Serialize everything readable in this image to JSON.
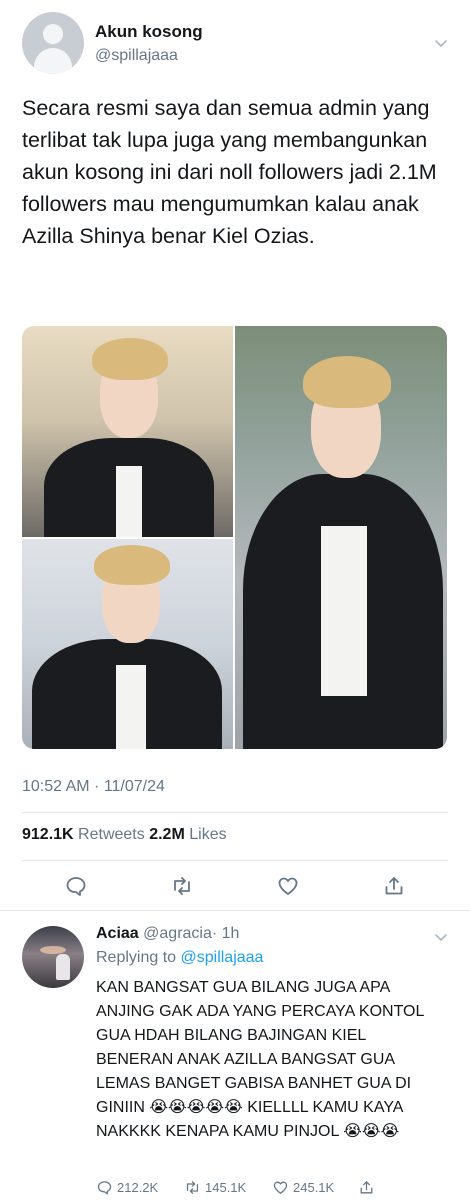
{
  "tweet": {
    "display_name": "Akun kosong",
    "handle": "@spillajaaa",
    "text": "Secara resmi saya dan semua admin yang terlibat tak lupa juga yang membangunkan akun kosong ini dari noll followers jadi 2.1M followers mau mengumumkan kalau anak Azilla Shinya benar Kiel Ozias.",
    "timestamp": "10:52 AM · 11/07/24",
    "retweets_count": "912.1K",
    "retweets_label": "Retweets",
    "likes_count": "2.2M",
    "likes_label": "Likes",
    "icons": [
      "chevron-down-icon",
      "reply-icon",
      "retweet-icon",
      "like-icon",
      "share-icon"
    ]
  },
  "reply": {
    "display_name": "Aciaa",
    "handle": "@agracia",
    "time": "· 1h",
    "replying_label": "Replying to",
    "replying_to": "@spillajaaa",
    "text": "KAN BANGSAT GUA BILANG JUGA APA ANJING GAK ADA YANG PERCAYA KONTOL GUA HDAH BILANG BAJINGAN KIEL BENERAN ANAK AZILLA BANGSAT GUA LEMAS BANGET GABISA BANHET GUA DI GINIIN 😭😭😭😭😭 KIELLLL KAMU KAYA NAKKKK KENAPA KAMU PINJOL 😭😭😭",
    "replies": "212.2K",
    "retweets": "145.1K",
    "likes": "245.1K"
  },
  "colors": {
    "text": "#14171a",
    "secondary": "#657786",
    "link": "#1da1f2",
    "divider": "#e1e8ed"
  }
}
